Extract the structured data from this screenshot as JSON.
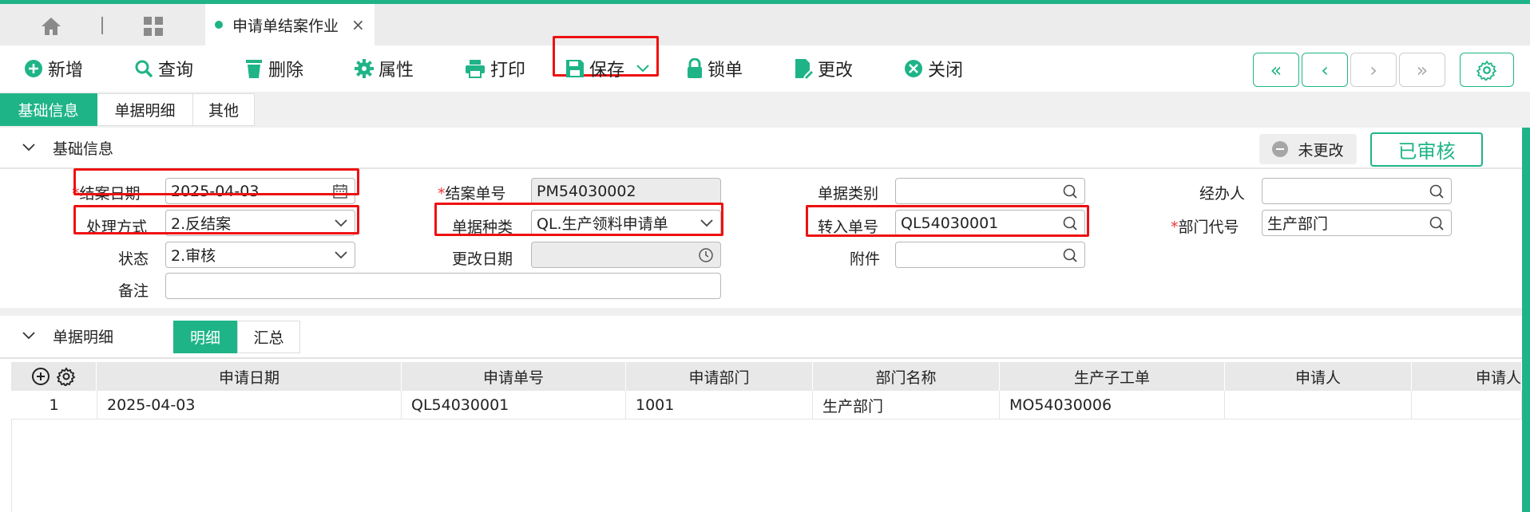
{
  "tab": {
    "label": "申请单结案作业",
    "close": "×"
  },
  "toolbar": {
    "add": "新增",
    "query": "查询",
    "delete": "删除",
    "props": "属性",
    "print": "打印",
    "save": "保存",
    "lock": "锁单",
    "modify": "更改",
    "close": "关闭"
  },
  "nav": {
    "first": "«",
    "prev": "‹",
    "next": "›",
    "last": "»"
  },
  "section_tabs": [
    "基础信息",
    "单据明细",
    "其他"
  ],
  "basic": {
    "title": "基础信息",
    "unchanged": "未更改",
    "approved": "已审核",
    "close_date": {
      "label": "结案日期",
      "value": "2025-04-03"
    },
    "close_no": {
      "label": "结案单号",
      "value": "PM54030002"
    },
    "doc_category": {
      "label": "单据类别",
      "value": ""
    },
    "handler": {
      "label": "经办人",
      "value": ""
    },
    "process_mode": {
      "label": "处理方式",
      "value": "2.反结案"
    },
    "doc_type": {
      "label": "单据种类",
      "value": "QL.生产领料申请单"
    },
    "transfer_no": {
      "label": "转入单号",
      "value": "QL54030001"
    },
    "dept_code": {
      "label": "部门代号",
      "value": "生产部门"
    },
    "status": {
      "label": "状态",
      "value": "2.审核"
    },
    "modify_date": {
      "label": "更改日期",
      "value": ""
    },
    "attachment": {
      "label": "附件",
      "value": ""
    },
    "remark": {
      "label": "备注",
      "value": ""
    }
  },
  "detail": {
    "title": "单据明细",
    "subtabs": [
      "明细",
      "汇总"
    ],
    "columns": [
      "申请日期",
      "申请单号",
      "申请部门",
      "部门名称",
      "生产子工单",
      "申请人",
      "申请人"
    ],
    "rows": [
      {
        "idx": "1",
        "date": "2025-04-03",
        "no": "QL54030001",
        "dept": "1001",
        "dept_name": "生产部门",
        "mo": "MO54030006",
        "applicant": "",
        "applicant2": ""
      }
    ]
  },
  "colors": {
    "accent": "#1fb487",
    "highlight": "#ee1111"
  }
}
